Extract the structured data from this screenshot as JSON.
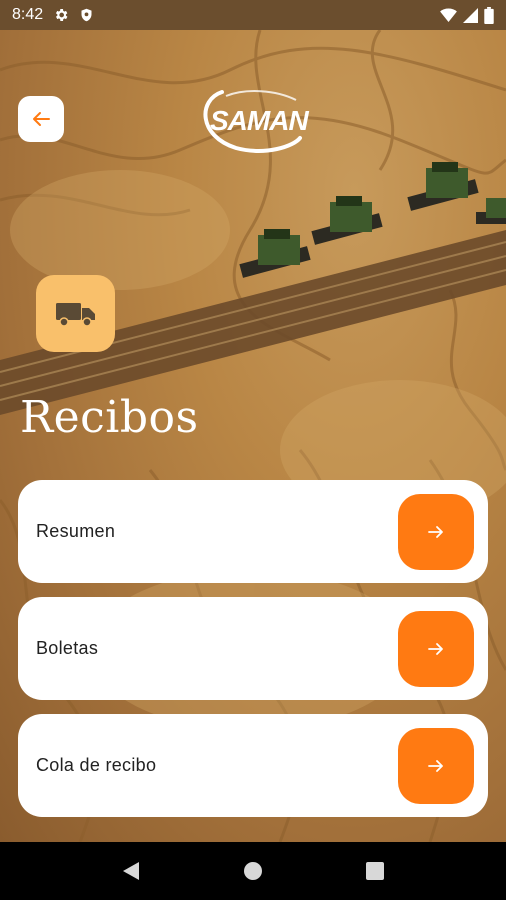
{
  "status_bar": {
    "time": "8:42",
    "left_icons": [
      "gear-icon",
      "shield-icon"
    ],
    "right_icons": [
      "wifi-icon",
      "signal-icon",
      "battery-icon"
    ]
  },
  "header": {
    "logo_text": "SAMAN"
  },
  "page": {
    "title": "Recibos",
    "badge_icon": "truck-icon"
  },
  "menu": {
    "items": [
      {
        "label": "Resumen"
      },
      {
        "label": "Boletas"
      },
      {
        "label": "Cola de recibo"
      }
    ]
  },
  "colors": {
    "accent": "#ff7a12",
    "badge": "#f9c06b",
    "status_bar": "#6b4e2e"
  },
  "nav_bar": {
    "buttons": [
      "back-triangle-icon",
      "home-circle-icon",
      "recents-square-icon"
    ]
  }
}
